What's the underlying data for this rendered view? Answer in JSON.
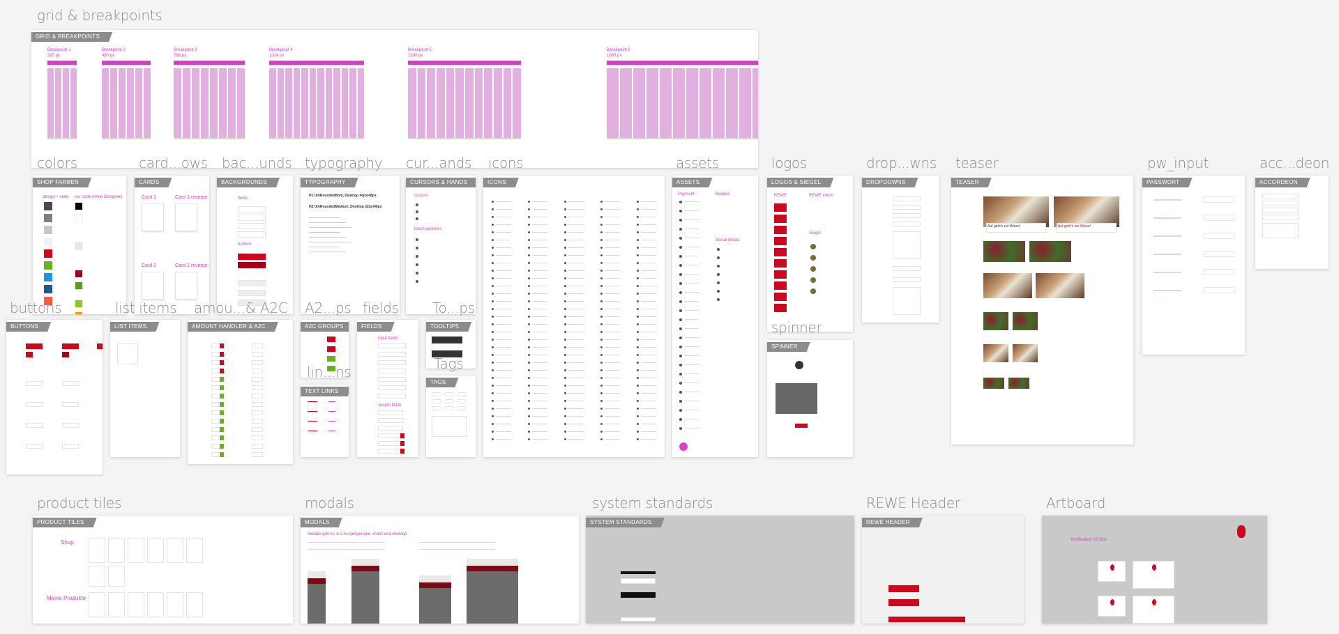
{
  "colors": {
    "accent": "#d63fbf",
    "brand_red": "#cc071e",
    "dark_red": "#a00018",
    "grid_column": "#e2b0e0",
    "panel_header": "#8c8c8c"
  },
  "artboards": [
    {
      "id": "grid",
      "label": "grid & breakpoints",
      "header": "GRID & BREAKPOINTS",
      "breakpoints": [
        {
          "name": "Breakpoint 1",
          "width": "320 px",
          "columns": 4
        },
        {
          "name": "Breakpoint 2",
          "width": "480 px",
          "columns": 6
        },
        {
          "name": "Breakpoint 3",
          "width": "768 px",
          "columns": 8
        },
        {
          "name": "Breakpoint 4",
          "width": "1024 px",
          "columns": 12
        },
        {
          "name": "Breakpoint 5",
          "width": "1280 px",
          "columns": 12
        },
        {
          "name": "Breakpoint 6",
          "width": "1680 px",
          "columns": 12
        }
      ]
    },
    {
      "id": "colors",
      "label": "colors",
      "header": "SHOP FARBEN",
      "columns": [
        "design + code",
        "nur code (ohne Designer)"
      ],
      "swatches_left": [
        "#4a4a4a",
        "#808080",
        "#c8c8c8",
        "#f2f2f2",
        "#cc071e",
        "#6ab023",
        "#1e96dc",
        "#1e5a8c",
        "#ff5a3c"
      ],
      "swatches_right": [
        "#000000",
        "#ffffff",
        "#e6e6e6",
        "#a0001e",
        "#5aa01e",
        "#8cc81e",
        "#ff9600"
      ]
    },
    {
      "id": "cards",
      "label": "card...ows",
      "header": "CARDS",
      "cards": [
        "Card 1",
        "Card 1 reverse",
        "Card 2",
        "Card 2 reverse"
      ]
    },
    {
      "id": "backgrounds",
      "label": "bac...unds",
      "header": "BACKGROUNDS",
      "sections": [
        "fields",
        "buttons"
      ]
    },
    {
      "id": "typography",
      "label": "typography",
      "header": "TYPOGRAPHY",
      "lines": [
        "H1 UniRoundedBold, Desktop 40px/48px",
        "H2 UniRoundedMedium, Desktop 32px/40px"
      ]
    },
    {
      "id": "cursors",
      "label": "cur...ands",
      "header": "CURSORS & HANDS",
      "sections": [
        "cursors",
        "touch gestures"
      ]
    },
    {
      "id": "icons",
      "label": "icons",
      "header": "ICONS"
    },
    {
      "id": "assets",
      "label": "assets",
      "header": "ASSETS",
      "sections": [
        "Payment",
        "Badges",
        "Social Media"
      ]
    },
    {
      "id": "logos",
      "label": "logos",
      "header": "LOGOS & SIEGEL",
      "sections": [
        "REWE",
        "REWE intern",
        "Siegel"
      ]
    },
    {
      "id": "spinner",
      "label": "spinner",
      "header": "SPINNER"
    },
    {
      "id": "dropdowns",
      "label": "drop...wns",
      "header": "DROPDOWNS"
    },
    {
      "id": "teaser",
      "label": "teaser",
      "header": "TEASER",
      "teaser_title": "Auf geht's zur Wiesn!"
    },
    {
      "id": "passwort",
      "label": "pw_input",
      "header": "PASSWORT"
    },
    {
      "id": "accordeon",
      "label": "acc...deon",
      "header": "ACCORDEON"
    },
    {
      "id": "buttons",
      "label": "buttons",
      "header": "BUTTONS"
    },
    {
      "id": "listitems",
      "label": "list items",
      "header": "LIST ITEMS"
    },
    {
      "id": "amount",
      "label": "amou...& A2C",
      "header": "AMOUNT HANDLER & A2C"
    },
    {
      "id": "a2c",
      "label": "A2...ps",
      "header": "A2C GROUPS"
    },
    {
      "id": "textlinks",
      "label": "lin...ns",
      "header": "TEXT LINKS"
    },
    {
      "id": "fields",
      "label": "fields",
      "header": "FIELDS",
      "sections": [
        "input fields",
        "search fields"
      ]
    },
    {
      "id": "tooltips",
      "label": "To...ps",
      "header": "TOOLTIPS"
    },
    {
      "id": "tags",
      "label": "Tags",
      "header": "TAGS"
    },
    {
      "id": "producttiles",
      "label": "product tiles",
      "header": "PRODUCT TILES",
      "sections": [
        "Shop",
        "Meine Produkte"
      ]
    },
    {
      "id": "modals",
      "label": "modals",
      "header": "MODALS",
      "intro": "Modals gibt es in 2 Ausprägungen: mobil und desktop"
    },
    {
      "id": "system",
      "label": "system standards",
      "header": "SYSTEM STANDARDS"
    },
    {
      "id": "header",
      "label": "REWE Header",
      "header": "REWE HEADER"
    },
    {
      "id": "artboard",
      "label": "Artboard",
      "header": "",
      "title": "Notification XS Box"
    }
  ]
}
